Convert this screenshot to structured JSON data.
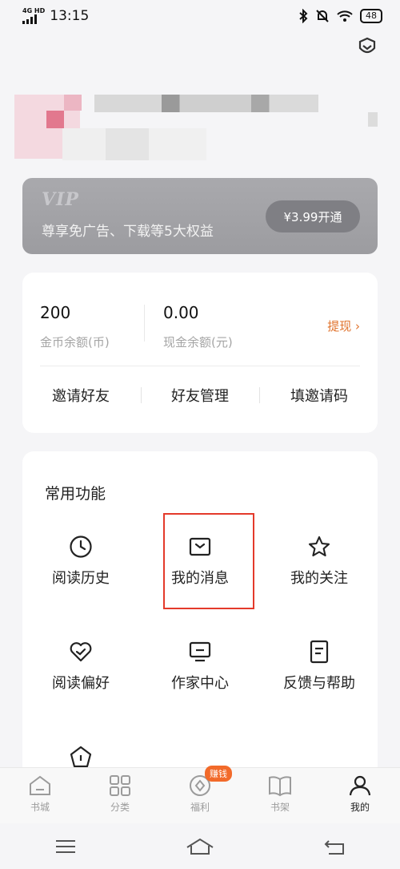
{
  "status_bar": {
    "network": "4G HD",
    "time": "13:15",
    "battery": "48"
  },
  "vip": {
    "logo": "VIP",
    "description": "尊享免广告、下载等5大权益",
    "button": "¥3.99开通"
  },
  "wallet": {
    "coins_value": "200",
    "coins_label": "金币余额(币)",
    "cash_value": "0.00",
    "cash_label": "现金余额(元)",
    "withdraw": "提现",
    "actions": [
      "邀请好友",
      "好友管理",
      "填邀请码"
    ]
  },
  "functions": {
    "title": "常用功能",
    "items": [
      {
        "label": "阅读历史",
        "icon": "clock-icon"
      },
      {
        "label": "我的消息",
        "icon": "message-icon"
      },
      {
        "label": "我的关注",
        "icon": "star-icon"
      },
      {
        "label": "阅读偏好",
        "icon": "heart-check-icon"
      },
      {
        "label": "作家中心",
        "icon": "monitor-icon"
      },
      {
        "label": "反馈与帮助",
        "icon": "document-icon"
      }
    ]
  },
  "tabbar": {
    "items": [
      {
        "label": "书城",
        "icon": "home-icon"
      },
      {
        "label": "分类",
        "icon": "grid-icon"
      },
      {
        "label": "福利",
        "icon": "coin-icon",
        "badge": "赚钱"
      },
      {
        "label": "书架",
        "icon": "book-icon"
      },
      {
        "label": "我的",
        "icon": "person-icon",
        "active": true
      }
    ]
  },
  "colors": {
    "accent": "#e0732d",
    "badge": "#f26a2a",
    "highlight_border": "#e43a2b",
    "vip_bg": "#a3a3a7"
  }
}
